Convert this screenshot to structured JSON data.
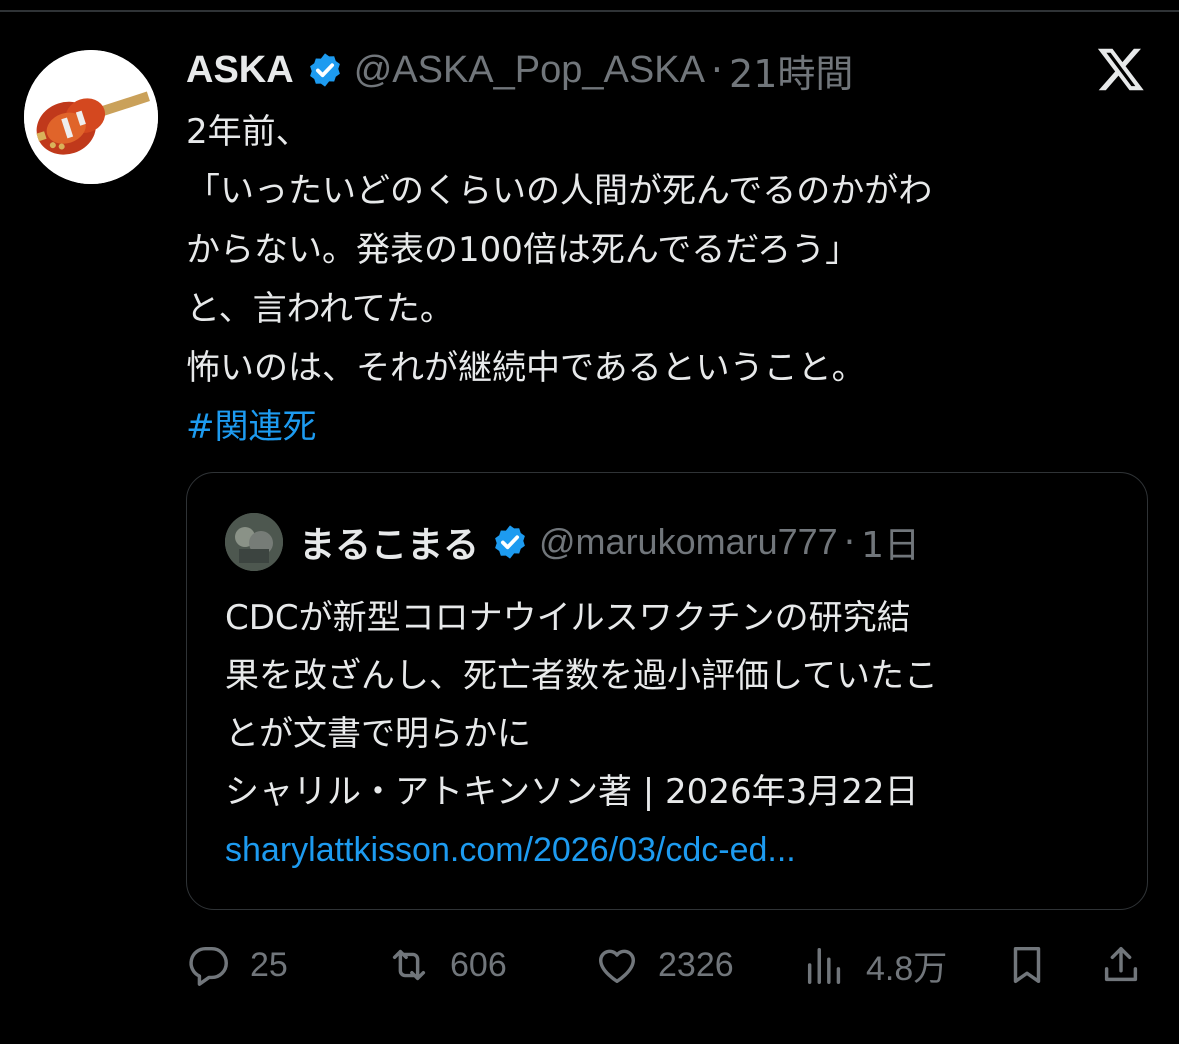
{
  "author": {
    "name": "ASKA",
    "handle": "@ASKA_Pop_ASKA",
    "separator": "·",
    "time": "21時間",
    "avatar_icon": "violin-bass-guitar-avatar"
  },
  "tweet": {
    "lines": [
      "2年前、",
      "「いったいどのくらいの人間が死んでるのかがわ",
      "からない。発表の100倍は死んでるだろう」",
      "と、言われてた。",
      "怖いのは、それが継続中であるということ。"
    ],
    "hashtag": "#関連死"
  },
  "quote": {
    "name": "まるこまる",
    "handle": "@marukomaru777",
    "separator": "·",
    "time": "1日",
    "lines": [
      "CDCが新型コロナウイルスワクチンの研究結",
      "果を改ざんし、死亡者数を過小評価していたこ",
      "とが文書で明らかに",
      "シャリル・アトキンソン著 | 2026年3月22日"
    ],
    "link": "sharylattkisson.com/2026/03/cdc-ed..."
  },
  "actions": {
    "replies": "25",
    "reposts": "606",
    "likes": "2326",
    "views": "4.8万"
  },
  "colors": {
    "background": "#000000",
    "text": "#e7e9ea",
    "secondary": "#71767b",
    "accent": "#1d9bf0",
    "border": "#2f3336"
  }
}
